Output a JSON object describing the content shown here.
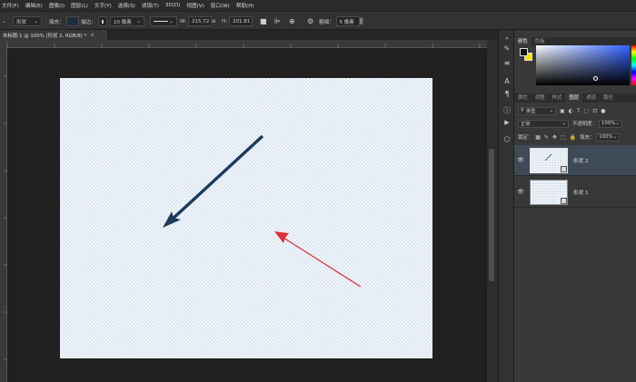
{
  "menu": [
    "文件(F)",
    "编辑(E)",
    "图像(I)",
    "图层(L)",
    "文字(Y)",
    "选择(S)",
    "滤镜(T)",
    "3D(D)",
    "视图(V)",
    "窗口(W)",
    "帮助(H)"
  ],
  "options": {
    "mode": "形状",
    "fill_label": "填充：",
    "stroke_label": "描边：",
    "stroke_size": "10 像素",
    "w_label": "W:",
    "w_value": "215.72",
    "h_label": "H:",
    "h_value": "201.81",
    "weight_label": "粗细：",
    "weight_value": "5 像素"
  },
  "document": {
    "tab_title": "未标题-1 @ 100% (形状 2, RGB/8) *",
    "close": "×"
  },
  "panel": {
    "color_tabs": [
      "颜色",
      "色板"
    ],
    "layer_tabs": [
      "属性",
      "调整",
      "样式",
      "图层",
      "通道",
      "路径"
    ],
    "active_layer_tab": "图层",
    "filter_kind": "类型",
    "blend_mode": "正常",
    "opacity_label": "不透明度：",
    "opacity_value": "100%",
    "lock_label": "锁定：",
    "fill_label": "填充：",
    "fill_value": "100%",
    "layers": [
      {
        "name": "形状 2",
        "selected": true
      },
      {
        "name": "形状 1",
        "selected": false
      }
    ]
  },
  "colors": {
    "dark_arrow": "#1d3a5a",
    "red_arrow": "#e0303a",
    "foreground": "#111111",
    "background": "#f2e600"
  }
}
